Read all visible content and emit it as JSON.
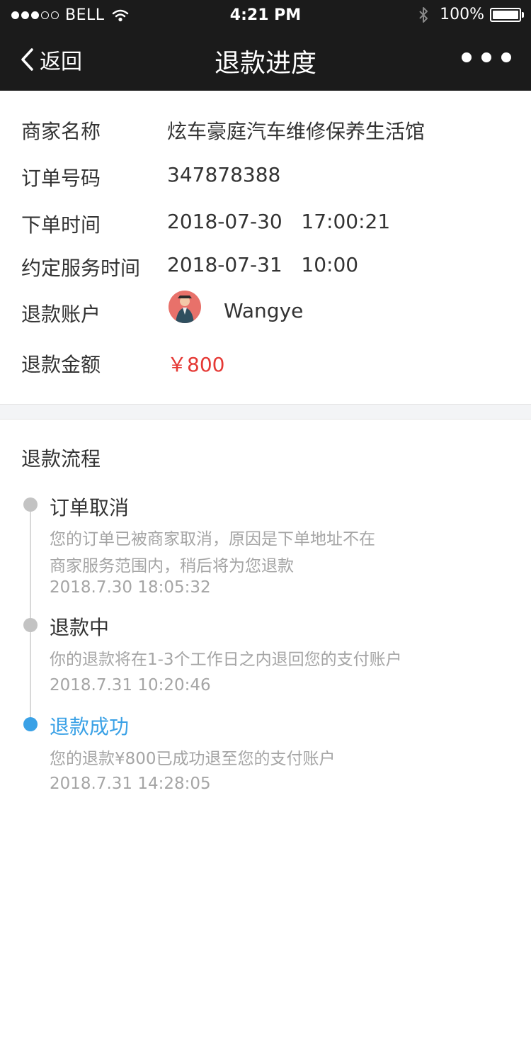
{
  "status_bar": {
    "carrier": "BELL",
    "time": "4:21 PM",
    "battery": "100%"
  },
  "nav": {
    "back_label": "返回",
    "title": "退款进度"
  },
  "info": {
    "merchant_label": "商家名称",
    "merchant_value": "炫车豪庭汽车维修保养生活馆",
    "order_no_label": "订单号码",
    "order_no_value": "347878388",
    "order_time_label": "下单时间",
    "order_time_value": "2018-07-30   17:00:21",
    "service_time_label": "约定服务时间",
    "service_time_value": "2018-07-31   10:00",
    "account_label": "退款账户",
    "account_name": "Wangye",
    "amount_label": "退款金额",
    "amount_value": "￥800"
  },
  "flow": {
    "title": "退款流程",
    "steps": [
      {
        "title": "订单取消",
        "line1": "您的订单已被商家取消，原因是下单地址不在",
        "line2": "商家服务范围内，稍后将为您退款",
        "time": "2018.7.30 18:05:32"
      },
      {
        "title": "退款中",
        "line1": "你的退款将在1-3个工作日之内退回您的支付账户",
        "time": "2018.7.31 10:20:46"
      },
      {
        "title": "退款成功",
        "line1": "您的退款¥800已成功退至您的支付账户",
        "time": "2018.7.31 14:28:05"
      }
    ]
  },
  "colors": {
    "nav_bg": "#1b1b1b",
    "accent": "#3aa1e6",
    "amount": "#e53935"
  }
}
